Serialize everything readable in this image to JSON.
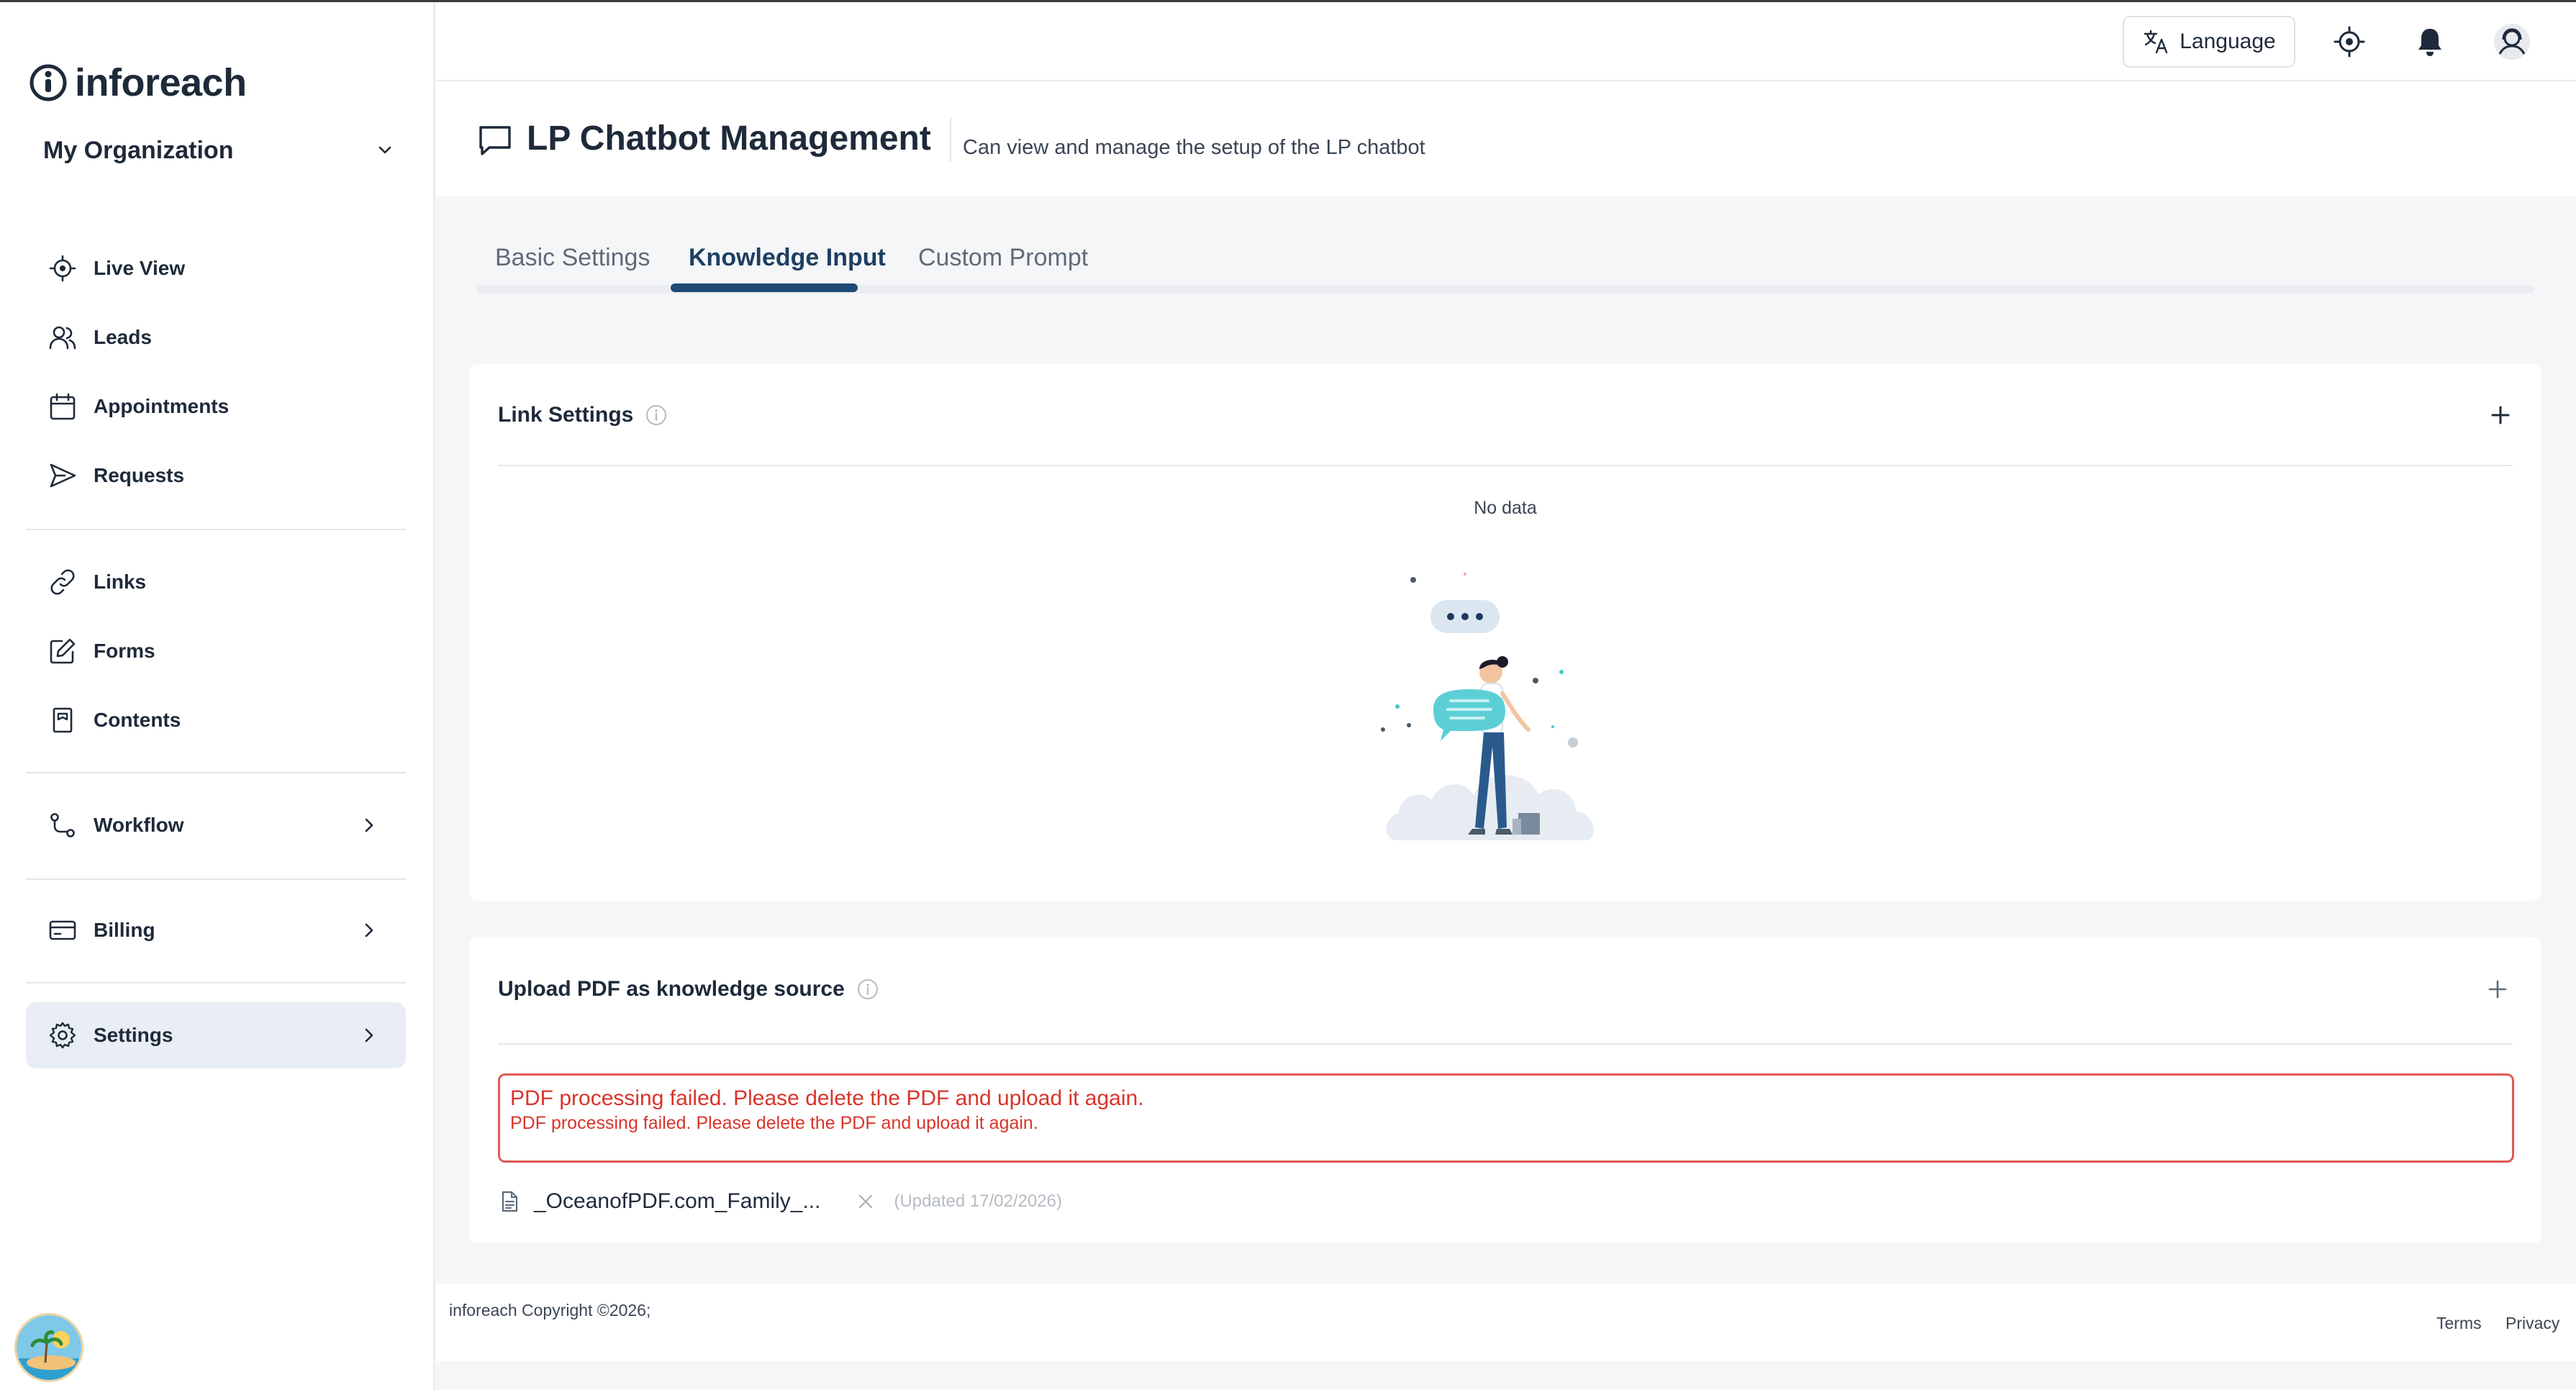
{
  "brand": {
    "name": "inforeach"
  },
  "org": {
    "label": "My Organization"
  },
  "sidebar": {
    "items": [
      {
        "label": "Live View",
        "icon": "target-icon"
      },
      {
        "label": "Leads",
        "icon": "users-icon"
      },
      {
        "label": "Appointments",
        "icon": "calendar-icon"
      },
      {
        "label": "Requests",
        "icon": "send-icon"
      },
      {
        "label": "Links",
        "icon": "link-icon"
      },
      {
        "label": "Forms",
        "icon": "edit-icon"
      },
      {
        "label": "Contents",
        "icon": "book-icon"
      },
      {
        "label": "Workflow",
        "icon": "workflow-icon"
      },
      {
        "label": "Billing",
        "icon": "card-icon"
      },
      {
        "label": "Settings",
        "icon": "gear-icon",
        "active": true
      }
    ]
  },
  "header": {
    "language_label": "Language"
  },
  "page": {
    "title": "LP Chatbot Management",
    "subtitle": "Can view and manage the setup of the LP chatbot"
  },
  "tabs": [
    {
      "label": "Basic Settings"
    },
    {
      "label": "Knowledge Input",
      "active": true
    },
    {
      "label": "Custom Prompt"
    }
  ],
  "link_settings": {
    "title": "Link Settings",
    "empty_text": "No data"
  },
  "upload_pdf": {
    "title": "Upload PDF as knowledge source",
    "error_title": "PDF processing failed. Please delete the PDF and upload it again.",
    "error_desc": "PDF processing failed. Please delete the PDF and upload it again.",
    "file_name": "_OceanofPDF.com_Family_...",
    "file_updated": "(Updated 17/02/2026)"
  },
  "footer": {
    "copyright": "inforeach Copyright ©2026;",
    "terms": "Terms",
    "privacy": "Privacy"
  },
  "colors": {
    "accent": "#1d4a73",
    "error": "#d9342b",
    "active_nav_bg": "#e9eef4"
  }
}
